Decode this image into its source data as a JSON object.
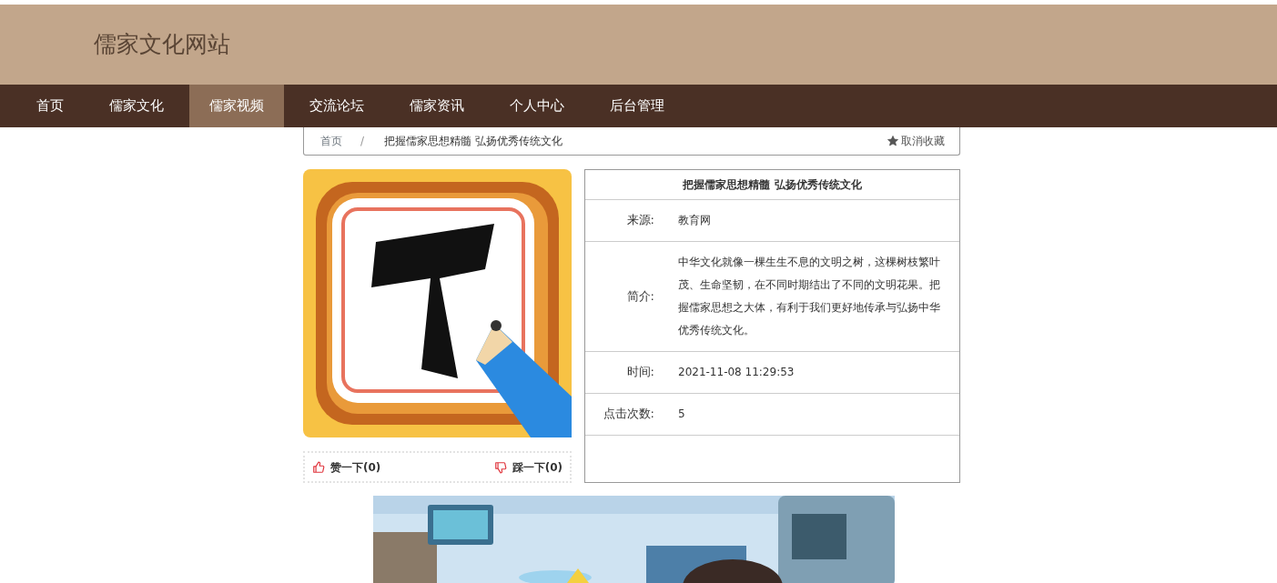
{
  "site": {
    "title": "儒家文化网站"
  },
  "nav": [
    {
      "label": "首页",
      "selected": false
    },
    {
      "label": "儒家文化",
      "selected": false
    },
    {
      "label": "儒家视频",
      "selected": true
    },
    {
      "label": "交流论坛",
      "selected": false
    },
    {
      "label": "儒家资讯",
      "selected": false
    },
    {
      "label": "个人中心",
      "selected": false
    },
    {
      "label": "后台管理",
      "selected": false
    }
  ],
  "breadcrumb": {
    "items": [
      "首页",
      "把握儒家思想精髓 弘扬优秀传统文化"
    ],
    "separator": "/",
    "favorite": {
      "label": "取消收藏",
      "favorited": true
    }
  },
  "votes": {
    "like": "赞一下(0)",
    "dislike": "踩一下(0)"
  },
  "details": {
    "title": "把握儒家思想精髓 弘扬优秀传统文化",
    "rows": [
      {
        "label": "来源:",
        "value": "教育网"
      },
      {
        "label": "简介:",
        "value": "中华文化就像一棵生生不息的文明之树，这棵树枝繁叶茂、生命坚韧，在不同时期结出了不同的文明花果。把握儒家思想之大体，有利于我们更好地传承与弘扬中华优秀传统文化。"
      },
      {
        "label": "时间:",
        "value": "2021-11-08 11:29:53"
      },
      {
        "label": "点击次数:",
        "value": "5"
      }
    ]
  }
}
